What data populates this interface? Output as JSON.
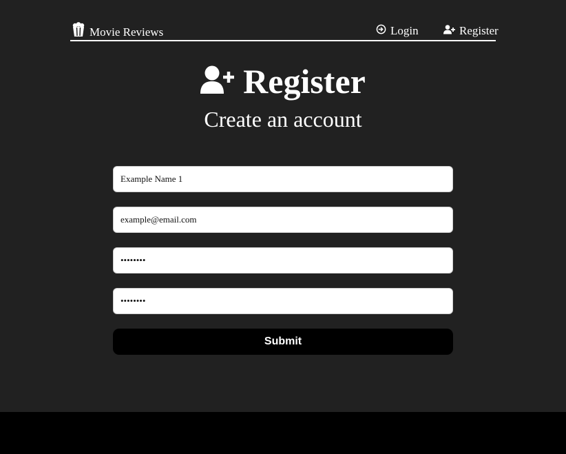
{
  "nav": {
    "brand_label": "Movie Reviews",
    "brand_icon": "popcorn-icon",
    "login_label": "Login",
    "login_icon": "sign-in-icon",
    "register_label": "Register",
    "register_icon": "user-plus-icon"
  },
  "main": {
    "title": "Register",
    "title_icon": "user-plus-icon",
    "subtitle": "Create an account"
  },
  "form": {
    "name_value": "Example Name 1",
    "email_value": "example@email.com",
    "password_value": "••••••••",
    "confirm_password_value": "••••••••",
    "submit_label": "Submit"
  },
  "colors": {
    "background": "#212121",
    "footer": "#000000",
    "text": "#ffffff",
    "button": "#000000"
  }
}
